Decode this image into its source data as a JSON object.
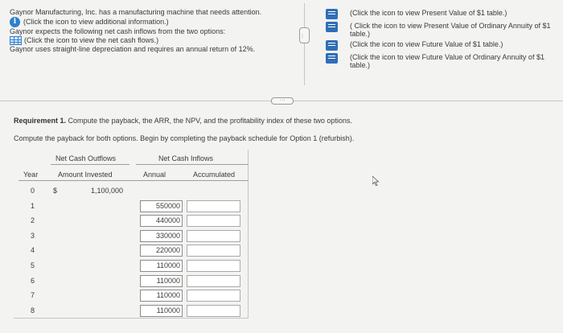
{
  "intro": {
    "line1": "Gaynor Manufacturing, Inc. has a manufacturing machine that needs attention.",
    "info_link": "(Click the icon to view additional information.)",
    "line2": "Gaynor expects the following net cash inflows from the two options:",
    "cash_flows_link": "(Click the icon to view the net cash flows.)",
    "line3": "Gaynor uses straight-line depreciation and requires an annual return of 12%."
  },
  "tables": [
    {
      "label": "(Click the icon to view Present Value of $1 table.)"
    },
    {
      "label": "( Click the icon to view Present Value of Ordinary Annuity of $1 table.)"
    },
    {
      "label": "(Click the icon to view Future Value of $1 table.)"
    },
    {
      "label": "(Click the icon to view Future Value of Ordinary Annuity of $1 table.)"
    }
  ],
  "requirement": {
    "prefix": "Requirement 1.",
    "text": " Compute the payback, the ARR, the NPV, and the profitability index of these two options.",
    "instruction": "Compute the payback for both options. Begin by completing the payback schedule for Option 1 (refurbish)."
  },
  "payback_table": {
    "group_outflows": "Net Cash Outflows",
    "group_inflows": "Net Cash Inflows",
    "col_year": "Year",
    "col_amount": "Amount Invested",
    "col_annual": "Annual",
    "col_accumulated": "Accumulated",
    "currency": "$",
    "rows": [
      {
        "year": "0",
        "invested": "1,100,000",
        "annual": "",
        "accumulated": ""
      },
      {
        "year": "1",
        "invested": "",
        "annual": "550000",
        "accumulated": ""
      },
      {
        "year": "2",
        "invested": "",
        "annual": "440000",
        "accumulated": ""
      },
      {
        "year": "3",
        "invested": "",
        "annual": "330000",
        "accumulated": ""
      },
      {
        "year": "4",
        "invested": "",
        "annual": "220000",
        "accumulated": ""
      },
      {
        "year": "5",
        "invested": "",
        "annual": "110000",
        "accumulated": ""
      },
      {
        "year": "6",
        "invested": "",
        "annual": "110000",
        "accumulated": ""
      },
      {
        "year": "7",
        "invested": "",
        "annual": "110000",
        "accumulated": ""
      },
      {
        "year": "8",
        "invested": "",
        "annual": "110000",
        "accumulated": ""
      }
    ]
  }
}
